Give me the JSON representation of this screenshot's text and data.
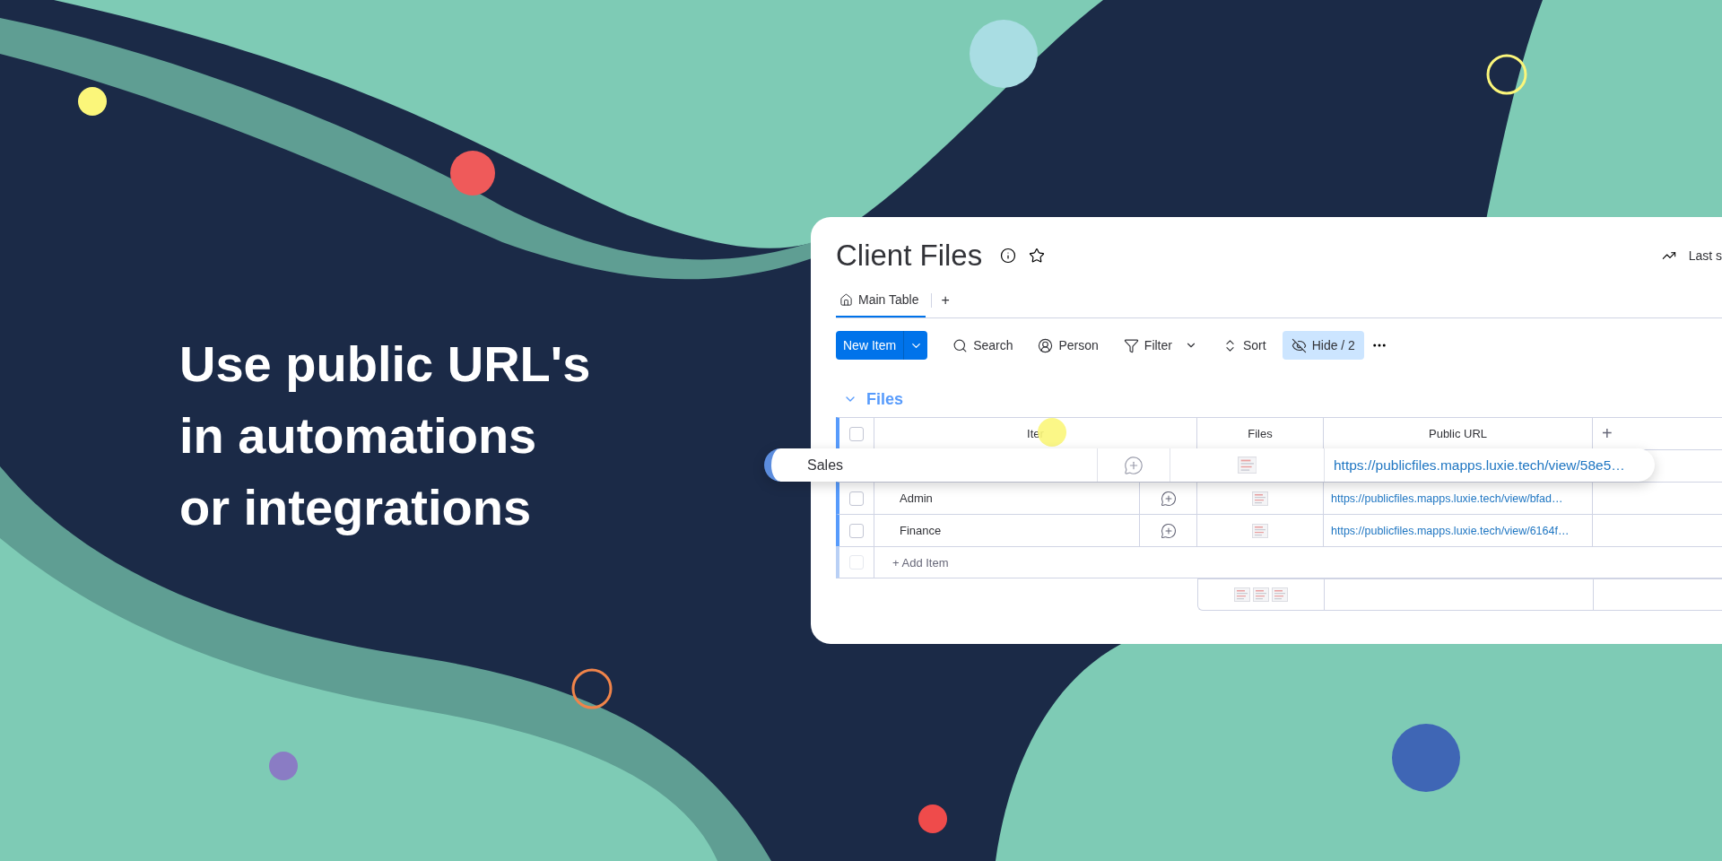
{
  "headline": [
    "Use public URL's",
    "in automations",
    "or integrations"
  ],
  "board": {
    "title": "Client Files",
    "last_saved": "Last s",
    "tabs": [
      {
        "label": "Main Table",
        "selected": true
      }
    ],
    "add_tab": "+",
    "new_item": "New Item",
    "tools": [
      {
        "kind": "search",
        "label": "Search",
        "selected": false
      },
      {
        "kind": "person",
        "label": "Person",
        "selected": false
      },
      {
        "kind": "filter",
        "label": "Filter",
        "selected": false
      },
      {
        "kind": "sort",
        "label": "Sort",
        "selected": false
      },
      {
        "kind": "hide",
        "label": "Hide / 2",
        "selected": true
      }
    ],
    "group": {
      "name": "Files",
      "expanded": true,
      "all_checked": false
    },
    "columns": [
      "Iter",
      "Files",
      "Public URL"
    ],
    "add_column": "+",
    "rows": [
      {
        "name": "Sales",
        "url": "https://publicfiles.mapps.luxie.tech/view/58e5…",
        "dragging": true
      },
      {
        "name": "Admin",
        "url": "https://publicfiles.mapps.luxie.tech/view/bfad…",
        "dragging": false,
        "checked": false
      },
      {
        "name": "Finance",
        "url": "https://publicfiles.mapps.luxie.tech/view/6164f…",
        "dragging": false,
        "checked": false
      }
    ],
    "add_item": "+ Add Item",
    "add_item_checked": false
  }
}
